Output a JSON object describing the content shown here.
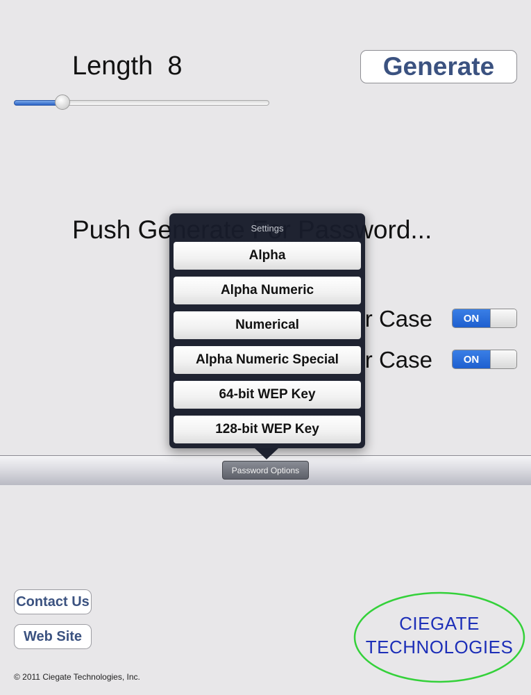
{
  "length": {
    "label": "Length",
    "value": "8",
    "slider_fraction": 0.19
  },
  "generate_label": "Generate",
  "message": "Push Generate For Password...",
  "toggles": [
    {
      "label": "r Case",
      "state": "ON"
    },
    {
      "label": "r Case",
      "state": "ON"
    }
  ],
  "popover": {
    "title": "Settings",
    "options": [
      "Alpha",
      "Alpha Numeric",
      "Numerical",
      "Alpha Numeric Special",
      "64-bit WEP Key",
      "128-bit WEP Key"
    ]
  },
  "toolbar": {
    "options_label": "Password Options"
  },
  "footer": {
    "contact_label": "Contact Us",
    "website_label": "Web Site",
    "copyright": "© 2011 Ciegate Technologies, Inc.",
    "logo_line1": "CIEGATE",
    "logo_line2": "TECHNOLOGIES"
  },
  "colors": {
    "accent_blue": "#2a64d1",
    "button_text": "#3b5280",
    "logo_ellipse": "#34d13a",
    "logo_text": "#1d2fb8"
  }
}
